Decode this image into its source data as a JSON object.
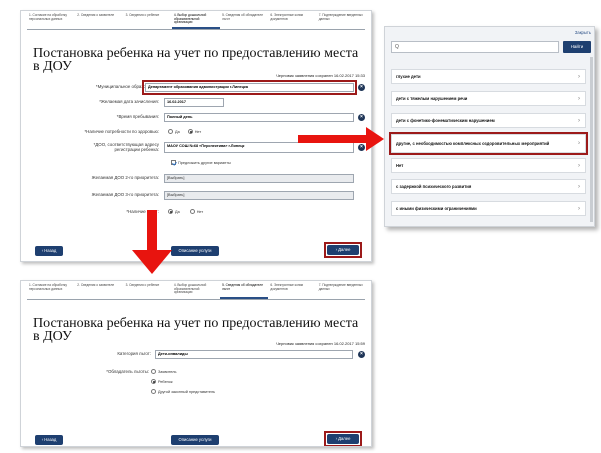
{
  "top_form": {
    "steps": [
      "1. Согласие на обработку персональных данных",
      "2. Сведения о заявителе",
      "3. Сведения о ребенке",
      "4. Выбор дошкольной образовательной организации",
      "5. Сведения об обладателе льгот",
      "6. Электронные копии документов",
      "7. Подтверждение введенных данных"
    ],
    "active_step": 3,
    "title": "Постановка ребенка на учет по предоставлению места в ДОУ",
    "draft_status": "Черновик заявления сохранен 16.02.2017 15:33",
    "fields": {
      "municipality_label": "*Муниципальное образование:",
      "municipality_value": "Департамент образования администрации г.Липецка",
      "desired_date_label": "*Желаемая дата зачисления:",
      "desired_date_value": "16.02.2017",
      "stay_time_label": "*Время пребывания:",
      "stay_time_value": "Полный день",
      "health_label": "*Наличие потребности по здоровью:",
      "health_options": [
        "Да",
        "Нет"
      ],
      "dou_label_line1": "*ДОО, соответствующая адресу",
      "dou_label_line2": "регистрации ребенка:",
      "dou_value": "МАОУ СОШ №68 «Перспектива» г.Липецк",
      "other_variants_label": "Предложить другие варианты",
      "priority2_label": "Желаемая ДОО 2-го приоритета:",
      "priority2_value": "[Выбрать]",
      "priority3_label": "Желаемая ДОО 3-го приоритета:",
      "priority3_value": "[Выбрать]",
      "benefit_label": "*Наличие льгот:",
      "benefit_options": [
        "Да",
        "Нет"
      ]
    },
    "buttons": {
      "back": "Назад",
      "describe": "Описание услуги",
      "next": "Далее"
    }
  },
  "dropdown": {
    "top_link": "Закрыть",
    "search_placeholder": "Q",
    "find_label": "Найти",
    "items": [
      "глухие дети",
      "дети с тяжелым нарушением речи",
      "дети с фонетико-фонематическим нарушением",
      "другие, с необходимостью комплексных оздоровительных мероприятий",
      "Нет",
      "с задержкой психического развития",
      "с иными физическими ограничениями"
    ],
    "selected_index": 3
  },
  "bottom_form": {
    "steps": [
      "1. Согласие на обработку персональных данных",
      "2. Сведения о заявителе",
      "3. Сведения о ребенке",
      "4. Выбор дошкольной образовательной организации",
      "5. Сведения об обладателе льгот",
      "6. Электронные копии документов",
      "7. Подтверждение введенных данных"
    ],
    "active_step": 4,
    "title": "Постановка ребенка на учет по предоставлению места в ДОУ",
    "draft_status": "Черновик заявления сохранен 16.02.2017 15:59",
    "fields": {
      "category_label": "Категория льгот:",
      "category_value": "Дети-инвалиды",
      "holder_label": "*Обладатель льготы:",
      "holder_options": [
        "Заявитель",
        "Ребенок",
        "Другой законный представитель"
      ],
      "holder_selected": 1
    },
    "buttons": {
      "back": "Назад",
      "describe": "Описание услуги",
      "next": "Далее"
    }
  },
  "colors": {
    "primary_button": "#1e3f70",
    "highlight": "#9c1a1a",
    "arrow": "#e8140f"
  }
}
